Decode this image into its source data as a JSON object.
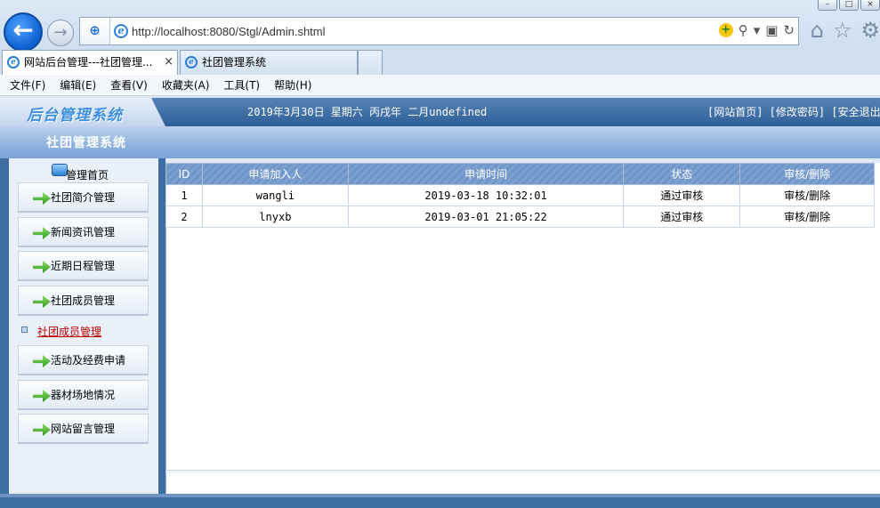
{
  "browser": {
    "url": "http://localhost:8080/Stgl/Admin.shtml",
    "tabs": [
      {
        "label": "网站后台管理---社团管理..."
      },
      {
        "label": "社团管理系统"
      }
    ],
    "tab_close_glyph": "×",
    "menu": [
      "文件(F)",
      "编辑(E)",
      "查看(V)",
      "收藏夹(A)",
      "工具(T)",
      "帮助(H)"
    ],
    "icons": {
      "back": "back-arrow-icon",
      "forward": "forward-arrow-icon",
      "shield": "shield-icon",
      "compat": "compat-view-icon",
      "search": "search-icon",
      "refresh": "refresh-icon",
      "home": "home-icon",
      "favorites": "star-icon",
      "tools": "gear-icon"
    }
  },
  "header": {
    "logo_text": "后台管理系统",
    "date": "2019年3月30日 星期六 丙戌年 二月undefined",
    "links": "[网站首页] [修改密码] [安全退出]",
    "system_title": "社团管理系统"
  },
  "sidebar": {
    "home_label": "管理首页",
    "items": [
      {
        "label": "社团简介管理"
      },
      {
        "label": "新闻资讯管理"
      },
      {
        "label": "近期日程管理"
      },
      {
        "label": "社团成员管理"
      }
    ],
    "active_label": "社团成员管理",
    "items_after": [
      {
        "label": "活动及经费申请"
      },
      {
        "label": "器材场地情况"
      },
      {
        "label": "网站留言管理"
      }
    ]
  },
  "table": {
    "headers": [
      "ID",
      "申请加入人",
      "申请时间",
      "状态",
      "审核/删除"
    ],
    "rows": [
      {
        "id": "1",
        "applicant": "wangli",
        "time": "2019-03-18 10:32:01",
        "status": "通过审核",
        "action": "审核/删除"
      },
      {
        "id": "2",
        "applicant": "lnyxb",
        "time": "2019-03-01 21:05:22",
        "status": "通过审核",
        "action": "审核/删除"
      }
    ]
  },
  "colors": {
    "header_band": "#2f5f98",
    "table_header": "#7ea2cf",
    "active_link": "#c00000",
    "sidebar_bg": "#e9f0f8"
  }
}
